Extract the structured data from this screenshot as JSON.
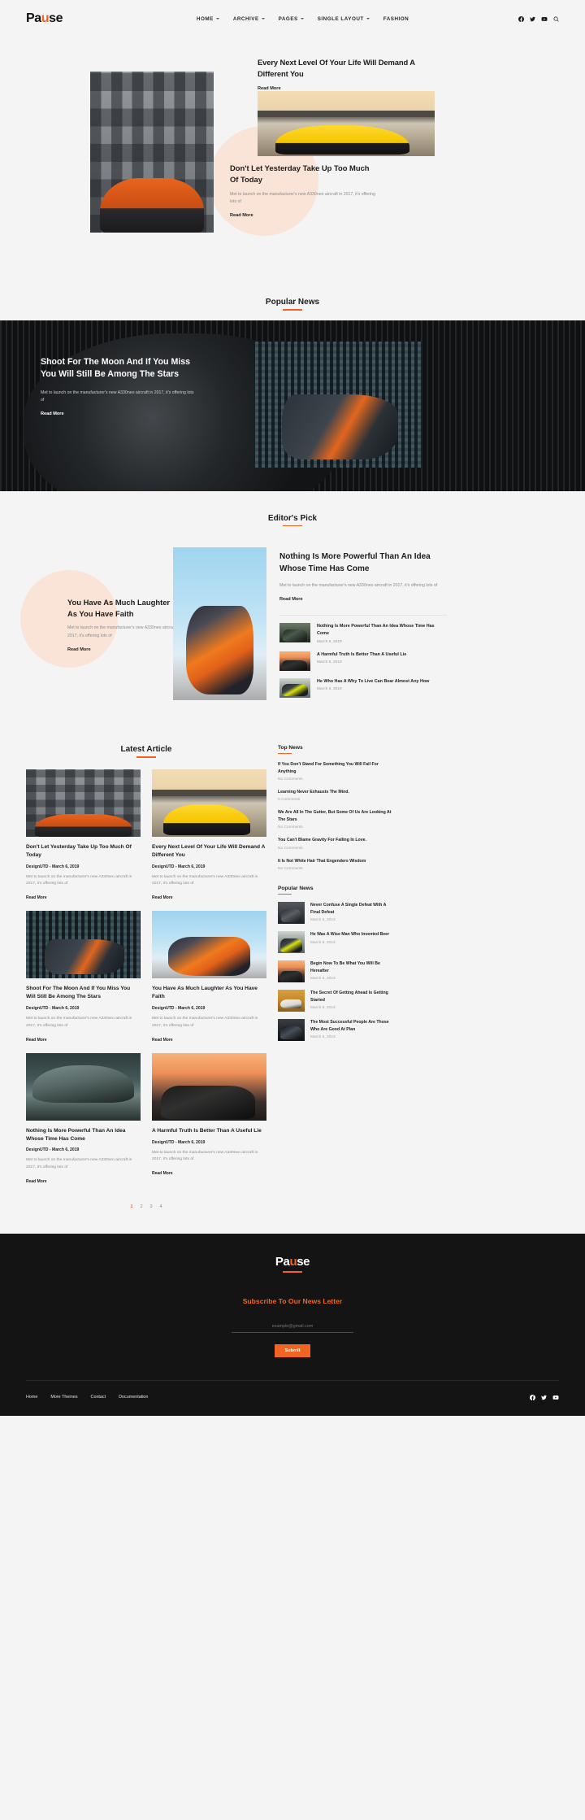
{
  "header": {
    "logo": {
      "pre": "Pa",
      "accent": "u",
      "post": "se"
    },
    "nav": [
      {
        "label": "HOME",
        "caret": true
      },
      {
        "label": "ARCHIVE",
        "caret": true
      },
      {
        "label": "PAGES",
        "caret": true
      },
      {
        "label": "SINGLE LAYOUT",
        "caret": true
      },
      {
        "label": "FASHION",
        "caret": false
      }
    ],
    "icons": [
      "facebook-icon",
      "twitter-icon",
      "youtube-icon",
      "search-icon"
    ]
  },
  "hero": {
    "top_right": {
      "title": "Every Next Level Of Your Life Will Demand A Different You",
      "read_more": "Read More"
    },
    "bottom": {
      "title": "Don't Let Yesterday Take Up Too Much Of Today",
      "excerpt": "Met to launch on the manufacturer's new A330neo aircraft in 2017, it's offering lots of",
      "read_more": "Read More"
    }
  },
  "popular_news_section": {
    "heading": "Popular News",
    "feature": {
      "title": "Shoot For The Moon And If You Miss You Will Still Be Among The Stars",
      "excerpt": "Met to launch on the manufacturer's new A330neo aircraft in 2017, it's offering lots of",
      "read_more": "Read More"
    }
  },
  "editors_pick": {
    "heading": "Editor's Pick",
    "left": {
      "title": "You Have As Much Laughter As You Have Faith",
      "excerpt": "Met to launch on the manufacturer's new A330neo aircraft in 2017, it's offering lots of",
      "read_more": "Read More"
    },
    "main": {
      "title": "Nothing Is More Powerful Than An Idea Whose Time Has Come",
      "excerpt": "Met to launch on the manufacturer's new A330neo aircraft in 2017, it's offering lots of",
      "read_more": "Read More"
    },
    "list": [
      {
        "title": "Nothing Is More Powerful Than An Idea Whose Time Has Come",
        "date": "March 6, 2019"
      },
      {
        "title": "A Harmful Truth Is Better Than A Useful Lie",
        "date": "March 6, 2019"
      },
      {
        "title": "He Who Has A Why To Live Can Bear Almost Any How",
        "date": "March 6, 2019"
      }
    ]
  },
  "latest": {
    "heading": "Latest Article",
    "cards": [
      {
        "title": "Don't Let Yesterday Take Up Too Much Of Today",
        "meta": "DesignUTD - March 6, 2019",
        "excerpt": "Met to launch on the manufacturer's new A330neo aircraft in 2017, it's offering lots of",
        "read_more": "Read More"
      },
      {
        "title": "Every Next Level Of Your Life Will Demand A Different You",
        "meta": "DesignUTD - March 6, 2019",
        "excerpt": "Met to launch on the manufacturer's new A330neo aircraft in 2017, it's offering lots of",
        "read_more": "Read More"
      },
      {
        "title": "Shoot For The Moon And If You Miss You Will Still Be Among The Stars",
        "meta": "DesignUTD - March 6, 2019",
        "excerpt": "Met to launch on the manufacturer's new A330neo aircraft in 2017, it's offering lots of",
        "read_more": "Read More"
      },
      {
        "title": "You Have As Much Laughter As You Have Faith",
        "meta": "DesignUTD - March 6, 2019",
        "excerpt": "Met to launch on the manufacturer's new A330neo aircraft in 2017, it's offering lots of",
        "read_more": "Read More"
      },
      {
        "title": "Nothing Is More Powerful Than An Idea Whose Time Has Come",
        "meta": "DesignUTD - March 6, 2019",
        "excerpt": "Met to launch on the manufacturer's new A330neo aircraft in 2017, it's offering lots of",
        "read_more": "Read More"
      },
      {
        "title": "A Harmful Truth Is Better Than A Useful Lie",
        "meta": "DesignUTD - March 6, 2019",
        "excerpt": "Met to launch on the manufacturer's new A330neo aircraft in 2017, it's offering lots of",
        "read_more": "Read More"
      }
    ],
    "pagination": [
      "1",
      "2",
      "3",
      "4"
    ],
    "pagination_active": "1"
  },
  "sidebar": {
    "top_news": {
      "heading": "Top News",
      "items": [
        {
          "title": "If You Don't Stand For Something You Will Fall For Anything",
          "comments": "No Comments"
        },
        {
          "title": "Learning Never Exhausts The Mind.",
          "comments": "5 Comments"
        },
        {
          "title": "We Are All In The Gutter, But Some Of Us Are Looking At The Stars",
          "comments": "No Comments"
        },
        {
          "title": "You Can't Blame Gravity For Falling In Love.",
          "comments": "No Comments"
        },
        {
          "title": "It Is Not White Hair That Engenders Wisdom",
          "comments": "No Comments"
        }
      ]
    },
    "popular_news": {
      "heading": "Popular News",
      "items": [
        {
          "title": "Never Confuse A Single Defeat With A Final Defeat",
          "date": "March 6, 2019"
        },
        {
          "title": "He Was A Wise Man Who Invented Beer",
          "date": "March 6, 2019"
        },
        {
          "title": "Begin Now To Be What You Will Be Hereafter",
          "date": "March 6, 2019"
        },
        {
          "title": "The Secret Of Getting Ahead Is Getting Started",
          "date": "March 6, 2019"
        },
        {
          "title": "The Most Successful People Are Those Who Are Good At Plan",
          "date": "March 6, 2019"
        }
      ]
    }
  },
  "footer": {
    "logo": {
      "pre": "Pa",
      "accent": "u",
      "post": "se"
    },
    "subscribe_title": "Subscribe To Our News Letter",
    "email_placeholder": "example@gmail.com",
    "submit_label": "Submit",
    "links": [
      "Home",
      "More Themes",
      "Contact",
      "Documentation"
    ],
    "social": [
      "facebook-icon",
      "twitter-icon",
      "youtube-icon"
    ]
  },
  "colors": {
    "accent": "#f26422",
    "page_bg": "#f4f4f4",
    "dark": "#141414",
    "blob": "#fae4d8"
  }
}
